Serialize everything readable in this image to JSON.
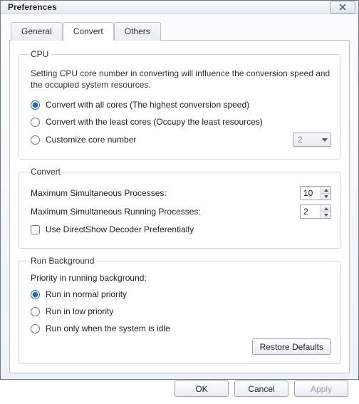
{
  "window": {
    "title": "Preferences"
  },
  "tabs": {
    "general": "General",
    "convert": "Convert",
    "others": "Others",
    "active": "convert"
  },
  "cpu": {
    "legend": "CPU",
    "desc": "Setting CPU core number in converting will influence the conversion speed and the occupied system resources.",
    "opt_all": "Convert with all cores (The highest conversion speed)",
    "opt_least": "Convert with the least cores (Occupy the least resources)",
    "opt_custom": "Customize core number",
    "selected": "all",
    "custom_cores": "2"
  },
  "convert": {
    "legend": "Convert",
    "max_proc_label": "Maximum Simultaneous Processes:",
    "max_proc_value": "10",
    "max_run_label": "Maximum Simultaneous Running Processes:",
    "max_run_value": "2",
    "use_dshow": "Use DirectShow Decoder Preferentially",
    "use_dshow_checked": false
  },
  "background": {
    "legend": "Run Background",
    "sub": "Priority in running background:",
    "opt_normal": "Run in normal priority",
    "opt_low": "Run in low priority",
    "opt_idle": "Run only when the system is idle",
    "selected": "normal"
  },
  "buttons": {
    "restore": "Restore Defaults",
    "ok": "OK",
    "cancel": "Cancel",
    "apply": "Apply"
  }
}
